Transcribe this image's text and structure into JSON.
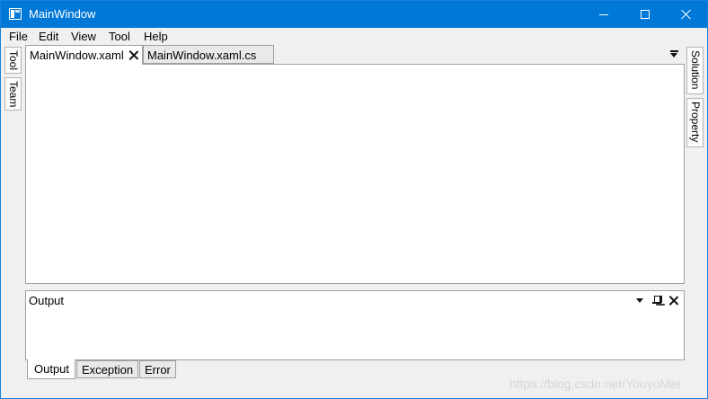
{
  "window": {
    "title": "MainWindow",
    "icon": "app-window-icon",
    "controls": [
      "minimize-icon",
      "maximize-icon",
      "close-icon"
    ]
  },
  "menu": {
    "items": [
      {
        "label": "File"
      },
      {
        "label": "Edit"
      },
      {
        "label": "View"
      },
      {
        "label": "Tool"
      },
      {
        "label": "Help"
      }
    ]
  },
  "left_side_tabs": [
    {
      "label": "Tool"
    },
    {
      "label": "Team"
    }
  ],
  "right_side_tabs": [
    {
      "label": "Solution"
    },
    {
      "label": "Property"
    }
  ],
  "documents": {
    "tabs": [
      {
        "label": "MainWindow.xaml",
        "active": true
      },
      {
        "label": "MainWindow.xaml.cs",
        "active": false
      }
    ]
  },
  "output_pane": {
    "title": "Output",
    "tabs": [
      {
        "label": "Output",
        "active": true
      },
      {
        "label": "Exception",
        "active": false
      },
      {
        "label": "Error",
        "active": false
      }
    ]
  },
  "watermark": "https://blog.csdn.net/YouyoMei",
  "colors": {
    "titlebar": "#0078d7",
    "window_background": "#f0f0f0",
    "panel_background": "#ffffff",
    "border": "#a0a0a0"
  }
}
